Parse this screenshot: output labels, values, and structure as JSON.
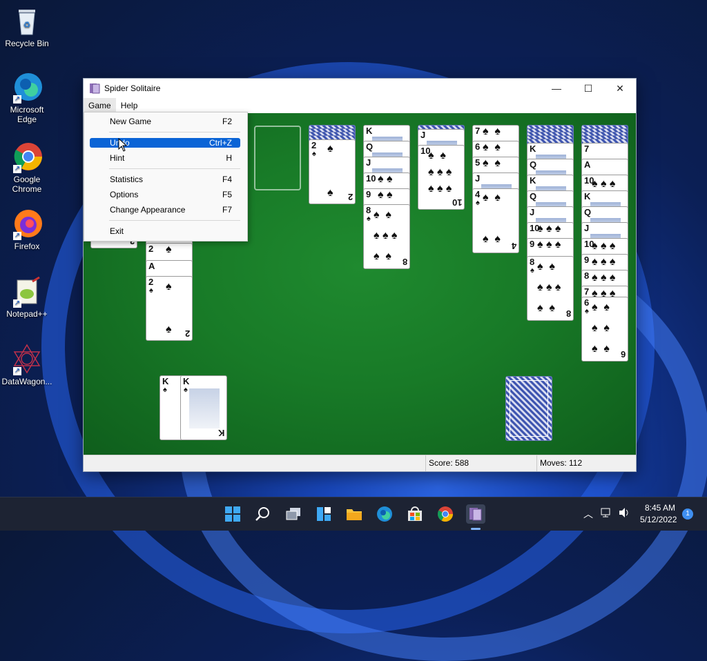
{
  "desktop": {
    "icons": [
      {
        "label": "Recycle Bin"
      },
      {
        "label": "Microsoft Edge"
      },
      {
        "label": "Google Chrome"
      },
      {
        "label": "Firefox"
      },
      {
        "label": "Notepad++"
      },
      {
        "label": "DataWagon..."
      }
    ]
  },
  "window": {
    "title": "Spider Solitaire",
    "controls": {
      "minimize": "—",
      "maximize": "☐",
      "close": "✕"
    },
    "menu": [
      "Game",
      "Help"
    ]
  },
  "game_menu": {
    "items": [
      {
        "label": "New Game",
        "shortcut": "F2"
      },
      {
        "label": "Undo",
        "shortcut": "Ctrl+Z"
      },
      {
        "label": "Hint",
        "shortcut": "H"
      },
      {
        "label": "Statistics",
        "shortcut": "F4"
      },
      {
        "label": "Options",
        "shortcut": "F5"
      },
      {
        "label": "Change Appearance",
        "shortcut": "F7"
      },
      {
        "label": "Exit",
        "shortcut": ""
      }
    ]
  },
  "status": {
    "score": "Score: 588",
    "moves": "Moves:  112"
  },
  "tableau": {
    "col2_cards": [
      "2",
      "A",
      "2"
    ],
    "col4_cards": [
      "2"
    ],
    "col5_cards": [
      "K",
      "Q",
      "J",
      "10",
      "9",
      "8"
    ],
    "col6_cards": [
      "J",
      "10"
    ],
    "col7_cards": [
      "7",
      "6",
      "5",
      "J",
      "4"
    ],
    "col8_cards": [
      "K",
      "Q",
      "K",
      "Q",
      "J",
      "10",
      "9",
      "8"
    ],
    "col9_cards": [
      "7",
      "A",
      "10",
      "K",
      "Q",
      "J",
      "10",
      "9",
      "8",
      "7",
      "6"
    ],
    "completed": [
      "K",
      "K"
    ],
    "suit": "♠"
  },
  "taskbar": {
    "time": "8:45 AM",
    "date": "5/12/2022",
    "notifications": "1",
    "icons": [
      "windows-start-icon",
      "search-icon",
      "task-view-icon",
      "widgets-icon",
      "file-explorer-icon",
      "edge-icon",
      "store-icon",
      "chrome-icon",
      "spider-solitaire-icon"
    ]
  }
}
